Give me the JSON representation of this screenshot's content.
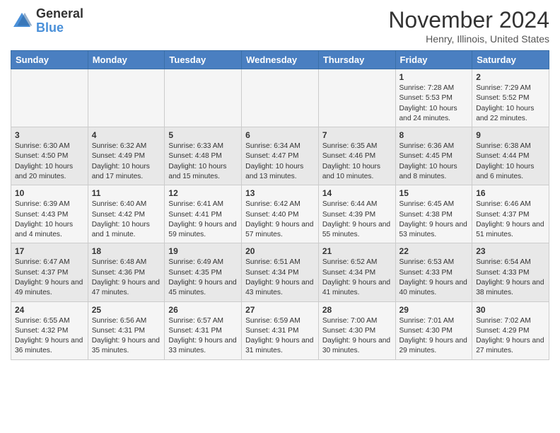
{
  "logo": {
    "general": "General",
    "blue": "Blue"
  },
  "header": {
    "month": "November 2024",
    "location": "Henry, Illinois, United States"
  },
  "days_of_week": [
    "Sunday",
    "Monday",
    "Tuesday",
    "Wednesday",
    "Thursday",
    "Friday",
    "Saturday"
  ],
  "weeks": [
    [
      {
        "day": "",
        "info": ""
      },
      {
        "day": "",
        "info": ""
      },
      {
        "day": "",
        "info": ""
      },
      {
        "day": "",
        "info": ""
      },
      {
        "day": "",
        "info": ""
      },
      {
        "day": "1",
        "info": "Sunrise: 7:28 AM\nSunset: 5:53 PM\nDaylight: 10 hours and 24 minutes."
      },
      {
        "day": "2",
        "info": "Sunrise: 7:29 AM\nSunset: 5:52 PM\nDaylight: 10 hours and 22 minutes."
      }
    ],
    [
      {
        "day": "3",
        "info": "Sunrise: 6:30 AM\nSunset: 4:50 PM\nDaylight: 10 hours and 20 minutes."
      },
      {
        "day": "4",
        "info": "Sunrise: 6:32 AM\nSunset: 4:49 PM\nDaylight: 10 hours and 17 minutes."
      },
      {
        "day": "5",
        "info": "Sunrise: 6:33 AM\nSunset: 4:48 PM\nDaylight: 10 hours and 15 minutes."
      },
      {
        "day": "6",
        "info": "Sunrise: 6:34 AM\nSunset: 4:47 PM\nDaylight: 10 hours and 13 minutes."
      },
      {
        "day": "7",
        "info": "Sunrise: 6:35 AM\nSunset: 4:46 PM\nDaylight: 10 hours and 10 minutes."
      },
      {
        "day": "8",
        "info": "Sunrise: 6:36 AM\nSunset: 4:45 PM\nDaylight: 10 hours and 8 minutes."
      },
      {
        "day": "9",
        "info": "Sunrise: 6:38 AM\nSunset: 4:44 PM\nDaylight: 10 hours and 6 minutes."
      }
    ],
    [
      {
        "day": "10",
        "info": "Sunrise: 6:39 AM\nSunset: 4:43 PM\nDaylight: 10 hours and 4 minutes."
      },
      {
        "day": "11",
        "info": "Sunrise: 6:40 AM\nSunset: 4:42 PM\nDaylight: 10 hours and 1 minute."
      },
      {
        "day": "12",
        "info": "Sunrise: 6:41 AM\nSunset: 4:41 PM\nDaylight: 9 hours and 59 minutes."
      },
      {
        "day": "13",
        "info": "Sunrise: 6:42 AM\nSunset: 4:40 PM\nDaylight: 9 hours and 57 minutes."
      },
      {
        "day": "14",
        "info": "Sunrise: 6:44 AM\nSunset: 4:39 PM\nDaylight: 9 hours and 55 minutes."
      },
      {
        "day": "15",
        "info": "Sunrise: 6:45 AM\nSunset: 4:38 PM\nDaylight: 9 hours and 53 minutes."
      },
      {
        "day": "16",
        "info": "Sunrise: 6:46 AM\nSunset: 4:37 PM\nDaylight: 9 hours and 51 minutes."
      }
    ],
    [
      {
        "day": "17",
        "info": "Sunrise: 6:47 AM\nSunset: 4:37 PM\nDaylight: 9 hours and 49 minutes."
      },
      {
        "day": "18",
        "info": "Sunrise: 6:48 AM\nSunset: 4:36 PM\nDaylight: 9 hours and 47 minutes."
      },
      {
        "day": "19",
        "info": "Sunrise: 6:49 AM\nSunset: 4:35 PM\nDaylight: 9 hours and 45 minutes."
      },
      {
        "day": "20",
        "info": "Sunrise: 6:51 AM\nSunset: 4:34 PM\nDaylight: 9 hours and 43 minutes."
      },
      {
        "day": "21",
        "info": "Sunrise: 6:52 AM\nSunset: 4:34 PM\nDaylight: 9 hours and 41 minutes."
      },
      {
        "day": "22",
        "info": "Sunrise: 6:53 AM\nSunset: 4:33 PM\nDaylight: 9 hours and 40 minutes."
      },
      {
        "day": "23",
        "info": "Sunrise: 6:54 AM\nSunset: 4:33 PM\nDaylight: 9 hours and 38 minutes."
      }
    ],
    [
      {
        "day": "24",
        "info": "Sunrise: 6:55 AM\nSunset: 4:32 PM\nDaylight: 9 hours and 36 minutes."
      },
      {
        "day": "25",
        "info": "Sunrise: 6:56 AM\nSunset: 4:31 PM\nDaylight: 9 hours and 35 minutes."
      },
      {
        "day": "26",
        "info": "Sunrise: 6:57 AM\nSunset: 4:31 PM\nDaylight: 9 hours and 33 minutes."
      },
      {
        "day": "27",
        "info": "Sunrise: 6:59 AM\nSunset: 4:31 PM\nDaylight: 9 hours and 31 minutes."
      },
      {
        "day": "28",
        "info": "Sunrise: 7:00 AM\nSunset: 4:30 PM\nDaylight: 9 hours and 30 minutes."
      },
      {
        "day": "29",
        "info": "Sunrise: 7:01 AM\nSunset: 4:30 PM\nDaylight: 9 hours and 29 minutes."
      },
      {
        "day": "30",
        "info": "Sunrise: 7:02 AM\nSunset: 4:29 PM\nDaylight: 9 hours and 27 minutes."
      }
    ]
  ]
}
